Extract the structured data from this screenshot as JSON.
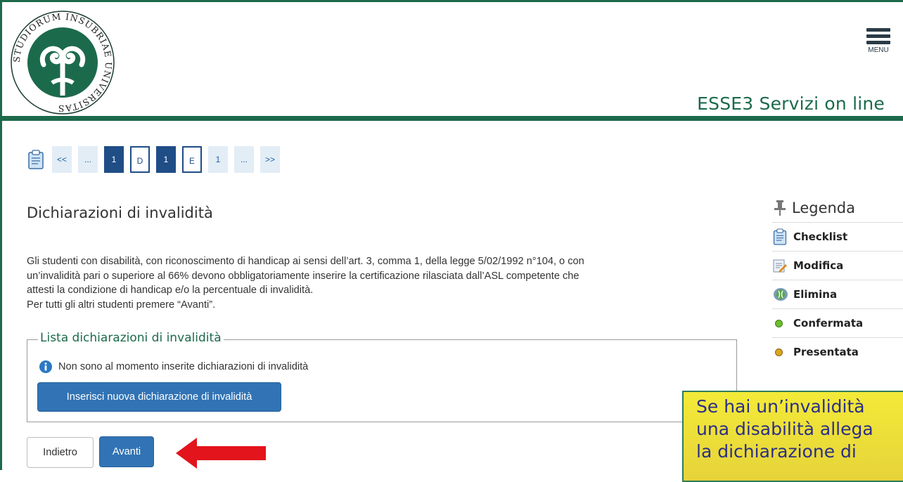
{
  "header": {
    "logo_text": "STUDIORUM INSUBRIAE UNIVERSITAS",
    "menu_label": "MENU",
    "site_title": "ESSE3 Servizi on line"
  },
  "nav": {
    "items": [
      {
        "label": "<<",
        "state": "normal"
      },
      {
        "label": "...",
        "state": "normal"
      },
      {
        "label": "1",
        "state": "active"
      },
      {
        "label": "D",
        "state": "outline"
      },
      {
        "label": "1",
        "state": "active"
      },
      {
        "label": "E",
        "state": "outline"
      },
      {
        "label": "1",
        "state": "normal"
      },
      {
        "label": "...",
        "state": "normal"
      },
      {
        "label": ">>",
        "state": "normal"
      }
    ]
  },
  "page": {
    "title": "Dichiarazioni di invalidità",
    "description_lines": [
      "Gli studenti con disabilità, con riconoscimento di handicap ai sensi dell’art. 3, comma 1, della legge 5/02/1992 n°104, o con",
      "un’invalidità pari o superiore al 66% devono obbligatoriamente inserire la certificazione rilasciata dall’ASL competente che",
      "attesti la condizione di handicap e/o la percentuale di invalidità.",
      "Per tutti gli altri studenti premere “Avanti”."
    ],
    "fieldset_legend": "Lista dichiarazioni di invalidità",
    "info_message": "Non sono al momento inserite dichiarazioni di invalidità",
    "insert_button": "Inserisci nuova dichiarazione di invalidità",
    "back_button": "Indietro",
    "next_button": "Avanti"
  },
  "legenda": {
    "title": "Legenda",
    "items": [
      {
        "label": "Checklist",
        "icon": "checklist-icon"
      },
      {
        "label": "Modifica",
        "icon": "edit-icon"
      },
      {
        "label": "Elimina",
        "icon": "delete-icon"
      },
      {
        "label": "Confermata",
        "icon": "green-dot-icon",
        "color": "#6cbf2f"
      },
      {
        "label": "Presentata",
        "icon": "yellow-dot-icon",
        "color": "#d9a521"
      }
    ]
  },
  "callout": {
    "lines": [
      "Se hai un’invalidità",
      "una disabilità allega",
      "la dichiarazione di"
    ]
  },
  "colors": {
    "brand_green": "#1c6a4c",
    "button_blue": "#3173b4",
    "nav_active": "#1f4d86",
    "arrow_red": "#e3141b",
    "callout_bg": "#eedf38"
  }
}
